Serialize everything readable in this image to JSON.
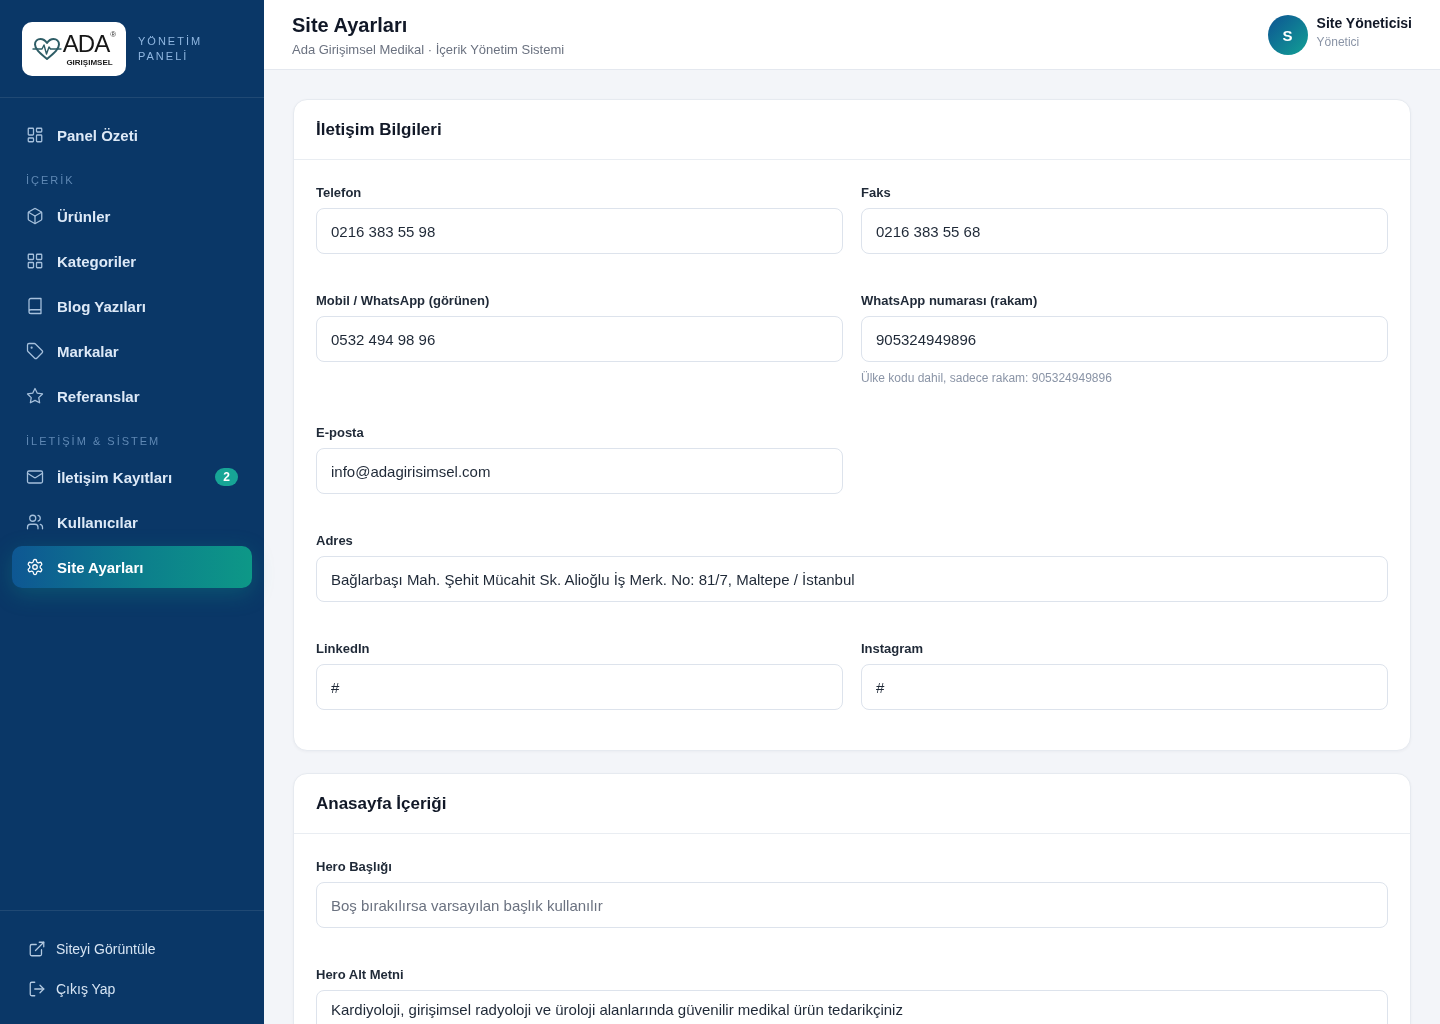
{
  "sidebar": {
    "logo": {
      "wordmark": "ADA",
      "registered": "®",
      "tagline": "GIRIŞIMSEL"
    },
    "panel_title": "YÖNETİM PANELİ",
    "sections": [
      {
        "items": [
          {
            "kind": "dashboard",
            "label": "Panel Özeti",
            "selected": false
          }
        ]
      },
      {
        "title": "İÇERİK",
        "items": [
          {
            "kind": "products",
            "label": "Ürünler",
            "selected": false
          },
          {
            "kind": "categories",
            "label": "Kategoriler",
            "selected": false
          },
          {
            "kind": "blog",
            "label": "Blog Yazıları",
            "selected": false
          },
          {
            "kind": "brands",
            "label": "Markalar",
            "selected": false
          },
          {
            "kind": "references",
            "label": "Referanslar",
            "selected": false
          }
        ]
      },
      {
        "title": "İLETİŞİM & SİSTEM",
        "items": [
          {
            "kind": "messages",
            "label": "İletişim Kayıtları",
            "badge": "2",
            "selected": false
          },
          {
            "kind": "users",
            "label": "Kullanıcılar",
            "selected": false
          },
          {
            "kind": "settings",
            "label": "Site Ayarları",
            "selected": true
          }
        ]
      }
    ],
    "footer_links": [
      {
        "kind": "site",
        "label": "Siteyi Görüntüle"
      },
      {
        "kind": "logout",
        "label": "Çıkış Yap"
      }
    ]
  },
  "header": {
    "title": "Site Ayarları",
    "subtitle": "Ada Girişimsel Medikal · İçerik Yönetim Sistemi",
    "user": {
      "initial": "S",
      "name": "Site Yöneticisi",
      "role": "Yönetici"
    }
  },
  "cards": [
    {
      "title": "İletişim Bilgileri",
      "fields": [
        {
          "kind": "half",
          "label": "Telefon",
          "value": "0216 383 55 98"
        },
        {
          "kind": "half",
          "label": "Faks",
          "value": "0216 383 55 68"
        },
        {
          "kind": "half",
          "label": "Mobil / WhatsApp (görünen)",
          "value": "0532 494 98 96"
        },
        {
          "kind": "half",
          "label": "WhatsApp numarası (rakam)",
          "value": "905324949896",
          "hint": "Ülke kodu dahil, sadece rakam: 905324949896"
        },
        {
          "kind": "half",
          "label": "E-posta",
          "value": "info@adagirisimsel.com"
        },
        {
          "kind": "full",
          "label": "Adres",
          "value": "Bağlarbaşı Mah. Şehit Mücahit Sk. Alioğlu İş Merk. No: 81/7, Maltepe / İstanbul"
        },
        {
          "kind": "half",
          "label": "LinkedIn",
          "value": "#"
        },
        {
          "kind": "half",
          "label": "Instagram",
          "value": "#"
        }
      ]
    },
    {
      "title": "Anasayfa İçeriği",
      "fields": [
        {
          "kind": "full",
          "label": "Hero Başlığı",
          "placeholder": "Boş bırakılırsa varsayılan başlık kullanılır"
        },
        {
          "kind": "textarea",
          "label": "Hero Alt Metni",
          "value": "Kardiyoloji, girişimsel radyoloji ve üroloji alanlarında güvenilir medikal ürün tedarikçiniz"
        }
      ]
    }
  ]
}
